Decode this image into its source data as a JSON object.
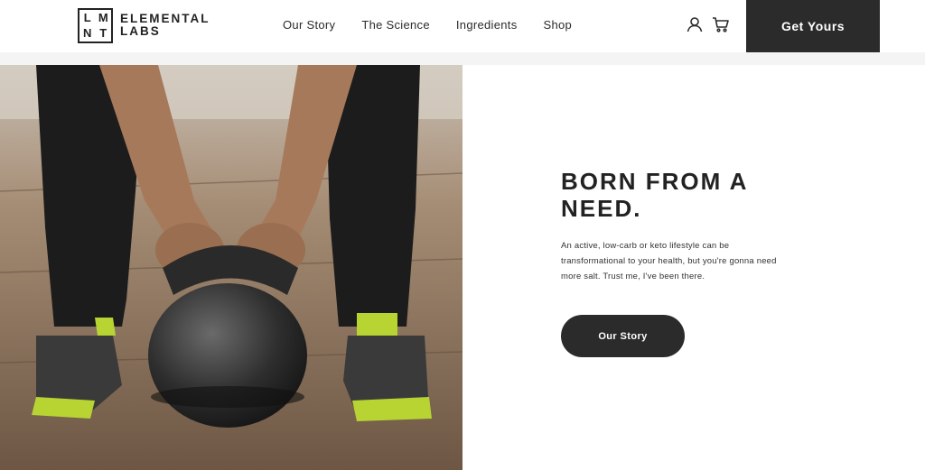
{
  "brand": {
    "logo_letters": [
      "L",
      "M",
      "N",
      "T"
    ],
    "name_line1": "ELEMENTAL",
    "name_line2": "LABS"
  },
  "nav": {
    "items": [
      {
        "label": "Our Story"
      },
      {
        "label": "The Science"
      },
      {
        "label": "Ingredients"
      },
      {
        "label": "Shop"
      }
    ]
  },
  "header": {
    "icons": [
      "user-icon",
      "cart-icon"
    ],
    "cta_label": "Get Yours"
  },
  "hero": {
    "title": "BORN FROM A NEED.",
    "body": "An active, low-carb or keto lifestyle can be transformational to your health, but you're gonna need more salt. Trust me, I've been there.",
    "button_label": "Our Story"
  },
  "colors": {
    "dark": "#2b2b2b",
    "text": "#222222",
    "divider": "#f4f4f5",
    "accent_lime": "#b8d432"
  }
}
